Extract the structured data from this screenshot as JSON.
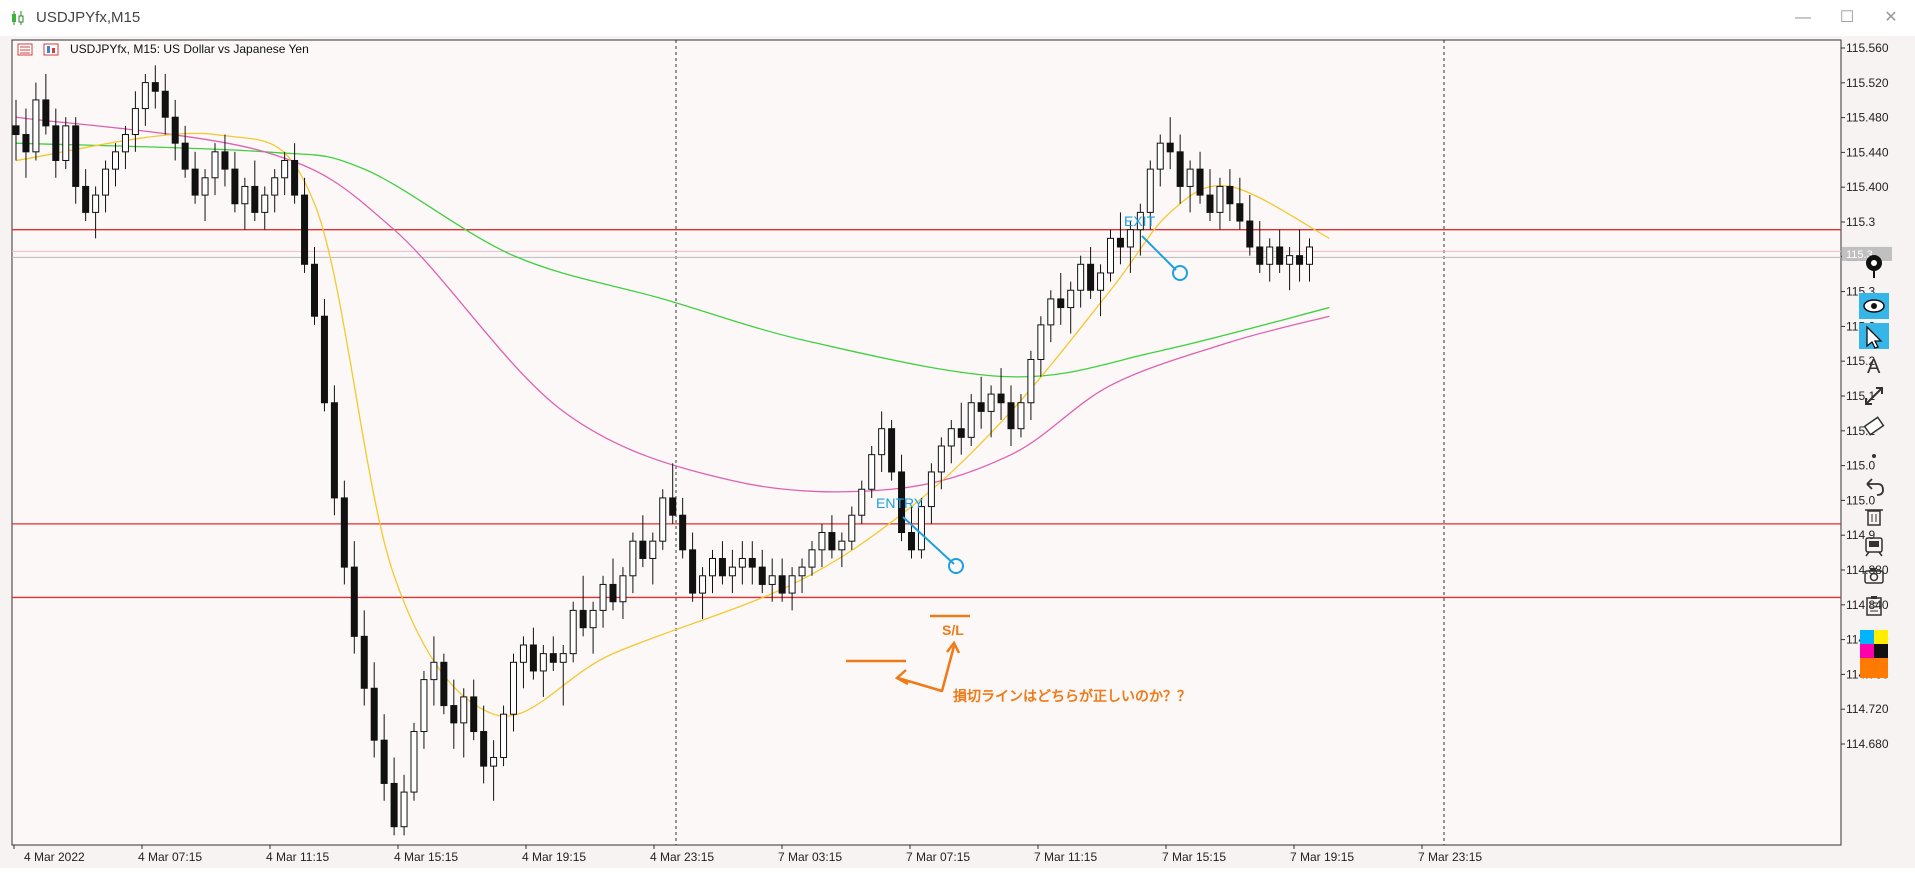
{
  "window": {
    "title": "USDJPYfx,M15",
    "controls": {
      "minimize": "—",
      "maximize": "☐",
      "close": "✕"
    }
  },
  "chart_header": "USDJPYfx, M15:  US Dollar vs Japanese Yen",
  "y_axis_labels": [
    "115.560",
    "115.520",
    "115.480",
    "115.440",
    "115.400",
    "115.3",
    "115.3",
    "115.3",
    "115.2",
    "115.2",
    "115.1",
    "115.1",
    "115.0",
    "115.0",
    "114.9",
    "114.880",
    "114.840",
    "114.800",
    "114.760",
    "114.720",
    "114.680"
  ],
  "price_label_current": "115.3",
  "x_axis_labels": [
    "4 Mar 2022",
    "4 Mar 07:15",
    "4 Mar 11:15",
    "4 Mar 15:15",
    "4 Mar 19:15",
    "4 Mar 23:15",
    "7 Mar 03:15",
    "7 Mar 07:15",
    "7 Mar 11:15",
    "7 Mar 15:15",
    "7 Mar 19:15",
    "7 Mar 23:15"
  ],
  "annotations": {
    "entry": "ENTRY",
    "exit": "EXIT",
    "sl": "S/L",
    "question": "損切ラインはどちらが正しいのか？？"
  },
  "colors": {
    "ma_fast": "#f5c830",
    "ma_mid": "#e060b0",
    "ma_slow": "#40d040",
    "horizontal_line": "#e03030",
    "annotation_blue": "#1ea0e0",
    "annotation_orange": "#f07a18"
  },
  "toolbar": {
    "tools": [
      "pin-icon",
      "eye-icon",
      "cursor-icon",
      "text-icon",
      "line-icon",
      "eraser-icon",
      "dot-icon",
      "undo-icon",
      "trash-icon",
      "bucket-icon",
      "camera-icon",
      "clipboard-icon",
      "color-palette-icon"
    ]
  },
  "chart_data": {
    "type": "candlestick",
    "symbol": "USDJPYfx",
    "timeframe": "M15",
    "ylim": [
      114.64,
      115.56
    ],
    "horizontal_lines": [
      115.35,
      115.01,
      114.925
    ],
    "candles": [
      [
        115.47,
        115.5,
        115.43,
        115.46
      ],
      [
        115.46,
        115.49,
        115.41,
        115.44
      ],
      [
        115.44,
        115.52,
        115.43,
        115.5
      ],
      [
        115.5,
        115.53,
        115.46,
        115.47
      ],
      [
        115.47,
        115.49,
        115.41,
        115.43
      ],
      [
        115.43,
        115.48,
        115.42,
        115.47
      ],
      [
        115.47,
        115.48,
        115.38,
        115.4
      ],
      [
        115.4,
        115.42,
        115.36,
        115.37
      ],
      [
        115.37,
        115.4,
        115.34,
        115.39
      ],
      [
        115.39,
        115.43,
        115.37,
        115.42
      ],
      [
        115.42,
        115.45,
        115.4,
        115.44
      ],
      [
        115.44,
        115.47,
        115.42,
        115.46
      ],
      [
        115.46,
        115.51,
        115.44,
        115.49
      ],
      [
        115.49,
        115.53,
        115.47,
        115.52
      ],
      [
        115.52,
        115.54,
        115.49,
        115.51
      ],
      [
        115.51,
        115.53,
        115.46,
        115.48
      ],
      [
        115.48,
        115.5,
        115.43,
        115.45
      ],
      [
        115.45,
        115.47,
        115.41,
        115.42
      ],
      [
        115.42,
        115.44,
        115.38,
        115.39
      ],
      [
        115.39,
        115.42,
        115.36,
        115.41
      ],
      [
        115.41,
        115.45,
        115.39,
        115.44
      ],
      [
        115.44,
        115.46,
        115.4,
        115.42
      ],
      [
        115.42,
        115.44,
        115.37,
        115.38
      ],
      [
        115.38,
        115.41,
        115.35,
        115.4
      ],
      [
        115.4,
        115.43,
        115.36,
        115.37
      ],
      [
        115.37,
        115.4,
        115.35,
        115.39
      ],
      [
        115.39,
        115.42,
        115.37,
        115.41
      ],
      [
        115.41,
        115.44,
        115.39,
        115.43
      ],
      [
        115.43,
        115.45,
        115.38,
        115.39
      ],
      [
        115.39,
        115.41,
        115.3,
        115.31
      ],
      [
        115.31,
        115.33,
        115.24,
        115.25
      ],
      [
        115.25,
        115.27,
        115.14,
        115.15
      ],
      [
        115.15,
        115.17,
        115.02,
        115.04
      ],
      [
        115.04,
        115.06,
        114.94,
        114.96
      ],
      [
        114.96,
        114.99,
        114.86,
        114.88
      ],
      [
        114.88,
        114.91,
        114.8,
        114.82
      ],
      [
        114.82,
        114.85,
        114.74,
        114.76
      ],
      [
        114.76,
        114.79,
        114.69,
        114.71
      ],
      [
        114.71,
        114.74,
        114.65,
        114.66
      ],
      [
        114.66,
        114.72,
        114.65,
        114.7
      ],
      [
        114.7,
        114.78,
        114.69,
        114.77
      ],
      [
        114.77,
        114.84,
        114.75,
        114.83
      ],
      [
        114.83,
        114.88,
        114.8,
        114.85
      ],
      [
        114.85,
        114.86,
        114.79,
        114.8
      ],
      [
        114.8,
        114.83,
        114.75,
        114.78
      ],
      [
        114.78,
        114.82,
        114.74,
        114.81
      ],
      [
        114.81,
        114.83,
        114.76,
        114.77
      ],
      [
        114.77,
        114.8,
        114.71,
        114.73
      ],
      [
        114.73,
        114.76,
        114.69,
        114.74
      ],
      [
        114.74,
        114.8,
        114.73,
        114.79
      ],
      [
        114.79,
        114.86,
        114.77,
        114.85
      ],
      [
        114.85,
        114.88,
        114.82,
        114.87
      ],
      [
        114.87,
        114.89,
        114.83,
        114.84
      ],
      [
        114.84,
        114.87,
        114.81,
        114.86
      ],
      [
        114.86,
        114.88,
        114.84,
        114.85
      ],
      [
        114.85,
        114.87,
        114.8,
        114.86
      ],
      [
        114.86,
        114.92,
        114.85,
        114.91
      ],
      [
        114.91,
        114.95,
        114.88,
        114.89
      ],
      [
        114.89,
        114.92,
        114.86,
        114.91
      ],
      [
        114.91,
        114.95,
        114.89,
        114.94
      ],
      [
        114.94,
        114.97,
        114.91,
        114.92
      ],
      [
        114.92,
        114.96,
        114.9,
        114.95
      ],
      [
        114.95,
        115.0,
        114.93,
        114.99
      ],
      [
        114.99,
        115.02,
        114.96,
        114.97
      ],
      [
        114.97,
        115.0,
        114.94,
        114.99
      ],
      [
        114.99,
        115.05,
        114.98,
        115.04
      ],
      [
        115.04,
        115.08,
        115.01,
        115.02
      ],
      [
        115.02,
        115.04,
        114.97,
        114.98
      ],
      [
        114.98,
        115.0,
        114.92,
        114.93
      ],
      [
        114.93,
        114.96,
        114.9,
        114.95
      ],
      [
        114.95,
        114.98,
        114.93,
        114.97
      ],
      [
        114.97,
        114.99,
        114.94,
        114.95
      ],
      [
        114.95,
        114.98,
        114.93,
        114.96
      ],
      [
        114.96,
        114.99,
        114.94,
        114.97
      ],
      [
        114.97,
        114.99,
        114.94,
        114.96
      ],
      [
        114.96,
        114.98,
        114.93,
        114.94
      ],
      [
        114.94,
        114.97,
        114.92,
        114.95
      ],
      [
        114.95,
        114.97,
        114.92,
        114.93
      ],
      [
        114.93,
        114.96,
        114.91,
        114.95
      ],
      [
        114.95,
        114.97,
        114.93,
        114.96
      ],
      [
        114.96,
        114.99,
        114.95,
        114.98
      ],
      [
        114.98,
        115.01,
        114.96,
        115.0
      ],
      [
        115.0,
        115.02,
        114.97,
        114.98
      ],
      [
        114.98,
        115.0,
        114.96,
        114.99
      ],
      [
        114.99,
        115.03,
        114.98,
        115.02
      ],
      [
        115.02,
        115.06,
        115.01,
        115.05
      ],
      [
        115.05,
        115.1,
        115.04,
        115.09
      ],
      [
        115.09,
        115.14,
        115.07,
        115.12
      ],
      [
        115.12,
        115.13,
        115.06,
        115.07
      ],
      [
        115.07,
        115.09,
        114.99,
        115.0
      ],
      [
        115.0,
        115.03,
        114.97,
        114.98
      ],
      [
        114.98,
        115.04,
        114.97,
        115.03
      ],
      [
        115.03,
        115.08,
        115.01,
        115.07
      ],
      [
        115.07,
        115.11,
        115.05,
        115.1
      ],
      [
        115.1,
        115.13,
        115.08,
        115.12
      ],
      [
        115.12,
        115.15,
        115.09,
        115.11
      ],
      [
        115.11,
        115.16,
        115.1,
        115.15
      ],
      [
        115.15,
        115.18,
        115.12,
        115.14
      ],
      [
        115.14,
        115.17,
        115.11,
        115.16
      ],
      [
        115.16,
        115.19,
        115.13,
        115.15
      ],
      [
        115.15,
        115.17,
        115.1,
        115.12
      ],
      [
        115.12,
        115.16,
        115.11,
        115.15
      ],
      [
        115.15,
        115.21,
        115.13,
        115.2
      ],
      [
        115.2,
        115.25,
        115.18,
        115.24
      ],
      [
        115.24,
        115.28,
        115.22,
        115.27
      ],
      [
        115.27,
        115.3,
        115.24,
        115.26
      ],
      [
        115.26,
        115.29,
        115.23,
        115.28
      ],
      [
        115.28,
        115.32,
        115.26,
        115.31
      ],
      [
        115.31,
        115.33,
        115.27,
        115.28
      ],
      [
        115.28,
        115.31,
        115.25,
        115.3
      ],
      [
        115.3,
        115.35,
        115.29,
        115.34
      ],
      [
        115.34,
        115.37,
        115.31,
        115.33
      ],
      [
        115.33,
        115.36,
        115.3,
        115.35
      ],
      [
        115.35,
        115.38,
        115.32,
        115.37
      ],
      [
        115.37,
        115.43,
        115.35,
        115.42
      ],
      [
        115.42,
        115.46,
        115.4,
        115.45
      ],
      [
        115.45,
        115.48,
        115.42,
        115.44
      ],
      [
        115.44,
        115.46,
        115.38,
        115.4
      ],
      [
        115.4,
        115.43,
        115.37,
        115.42
      ],
      [
        115.42,
        115.44,
        115.38,
        115.39
      ],
      [
        115.39,
        115.42,
        115.36,
        115.37
      ],
      [
        115.37,
        115.41,
        115.35,
        115.4
      ],
      [
        115.4,
        115.42,
        115.36,
        115.38
      ],
      [
        115.38,
        115.41,
        115.35,
        115.36
      ],
      [
        115.36,
        115.39,
        115.32,
        115.33
      ],
      [
        115.33,
        115.36,
        115.3,
        115.31
      ],
      [
        115.31,
        115.34,
        115.29,
        115.33
      ],
      [
        115.33,
        115.35,
        115.3,
        115.31
      ],
      [
        115.31,
        115.33,
        115.28,
        115.32
      ],
      [
        115.32,
        115.35,
        115.29,
        115.31
      ],
      [
        115.31,
        115.34,
        115.29,
        115.33
      ]
    ],
    "ma_fast_points": [
      [
        0,
        115.43
      ],
      [
        20,
        115.46
      ],
      [
        30,
        115.38
      ],
      [
        38,
        114.95
      ],
      [
        48,
        114.79
      ],
      [
        60,
        114.86
      ],
      [
        78,
        114.94
      ],
      [
        90,
        115.03
      ],
      [
        100,
        115.14
      ],
      [
        110,
        115.28
      ],
      [
        116,
        115.37
      ],
      [
        122,
        115.4
      ],
      [
        132,
        115.34
      ]
    ],
    "ma_mid_points": [
      [
        0,
        115.48
      ],
      [
        25,
        115.44
      ],
      [
        38,
        115.35
      ],
      [
        55,
        115.14
      ],
      [
        72,
        115.06
      ],
      [
        88,
        115.05
      ],
      [
        100,
        115.09
      ],
      [
        110,
        115.17
      ],
      [
        122,
        115.22
      ],
      [
        132,
        115.25
      ]
    ],
    "ma_slow_points": [
      [
        0,
        115.45
      ],
      [
        25,
        115.44
      ],
      [
        35,
        115.42
      ],
      [
        50,
        115.32
      ],
      [
        65,
        115.27
      ],
      [
        80,
        115.22
      ],
      [
        100,
        115.18
      ],
      [
        115,
        115.21
      ],
      [
        132,
        115.26
      ]
    ]
  }
}
